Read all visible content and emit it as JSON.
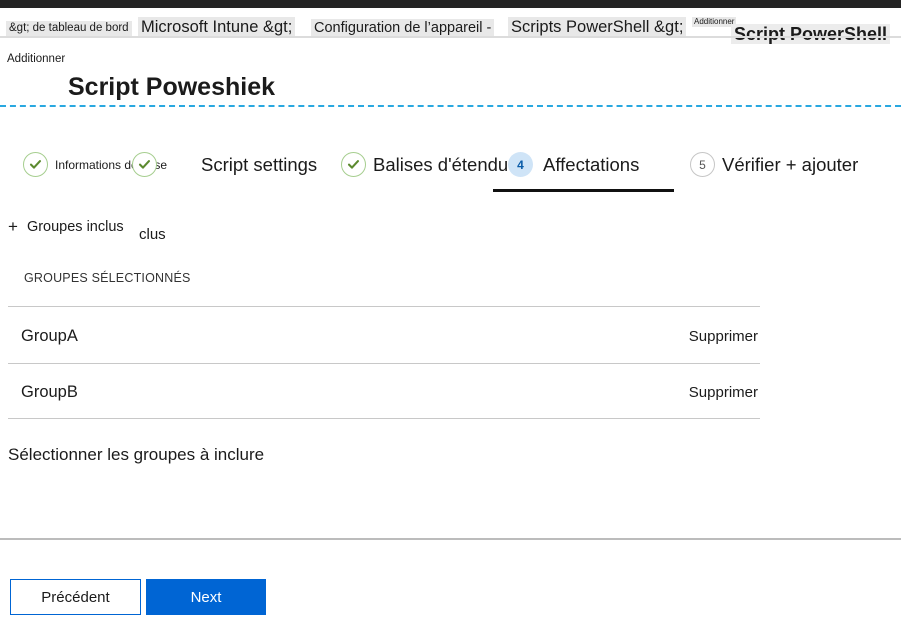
{
  "breadcrumb": {
    "items": [
      "&gt; de tableau de bord",
      "Microsoft Intune &gt;",
      "Configuration de l’appareil -",
      "Scripts PowerShell &gt;",
      "Additionner",
      "Script PowerShell"
    ]
  },
  "page": {
    "title_kicker": "Additionner",
    "title": "Script Poweshiek"
  },
  "wizard": {
    "steps": [
      {
        "index": "1",
        "label": "Informations de base",
        "state": "done"
      },
      {
        "index": "2",
        "label": "Script settings",
        "state": "done"
      },
      {
        "index": "3",
        "label": "Balises d'étendue",
        "state": "done"
      },
      {
        "index": "4",
        "label": "Affectations",
        "state": "current"
      },
      {
        "index": "5",
        "label": "Vérifier + ajouter",
        "state": "pending"
      }
    ]
  },
  "assignments": {
    "included_groups_label": "Groupes inclus",
    "plus_glyph": "+",
    "artifact_a": "clus",
    "artifact_b": ".",
    "table_header": "GROUPES SÉLECTIONNÉS",
    "rows": [
      {
        "name": "GroupA",
        "action": "Supprimer"
      },
      {
        "name": "GroupB",
        "action": "Supprimer"
      }
    ],
    "hint": "Sélectionner les groupes à inclure"
  },
  "footer": {
    "previous_label": "Précédent",
    "next_label": "Next"
  },
  "colors": {
    "accent_blue": "#0065d4",
    "dashed_rule": "#29a8e0",
    "step_done_green": "#5c8a2f",
    "step_current_badge_bg": "#cfe4f7",
    "top_strip": "#242424"
  }
}
